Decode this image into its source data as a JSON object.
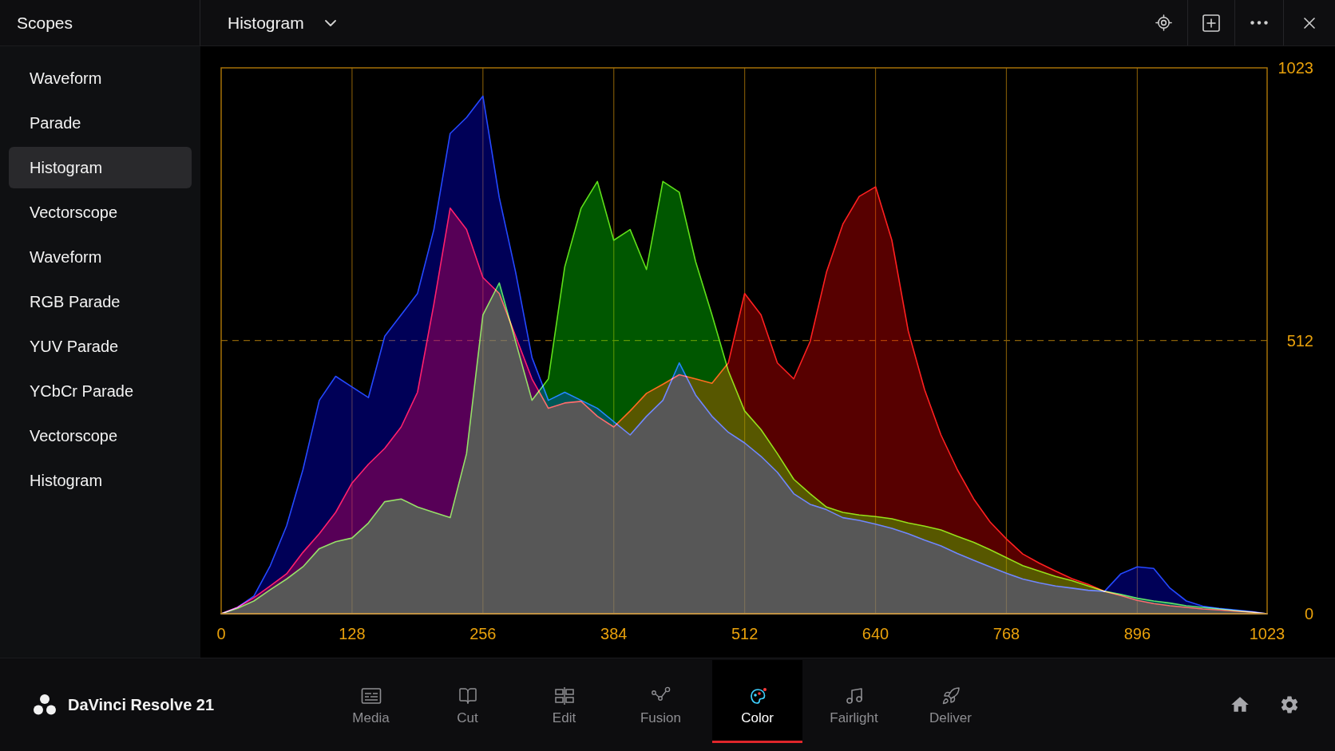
{
  "panel": {
    "title": "Scopes"
  },
  "scope_selector": {
    "value": "Histogram"
  },
  "sidebar": {
    "items": [
      {
        "label": "Waveform",
        "selected": false
      },
      {
        "label": "Parade",
        "selected": false
      },
      {
        "label": "Histogram",
        "selected": true
      },
      {
        "label": "Vectorscope",
        "selected": false
      },
      {
        "label": "Waveform",
        "selected": false
      },
      {
        "label": "RGB Parade",
        "selected": false
      },
      {
        "label": "YUV Parade",
        "selected": false
      },
      {
        "label": "YCbCr Parade",
        "selected": false
      },
      {
        "label": "Vectorscope",
        "selected": false
      },
      {
        "label": "Histogram",
        "selected": false
      }
    ]
  },
  "histogram": {
    "chart_data": {
      "type": "area",
      "x": [
        0,
        16,
        32,
        48,
        64,
        80,
        96,
        112,
        128,
        144,
        160,
        176,
        192,
        208,
        224,
        240,
        256,
        272,
        288,
        304,
        320,
        336,
        352,
        368,
        384,
        400,
        416,
        432,
        448,
        464,
        480,
        496,
        512,
        528,
        544,
        560,
        576,
        592,
        608,
        624,
        640,
        656,
        672,
        688,
        704,
        720,
        736,
        752,
        768,
        784,
        800,
        816,
        832,
        848,
        864,
        880,
        896,
        912,
        928,
        944,
        960,
        976,
        992,
        1008,
        1023
      ],
      "series": [
        {
          "color": "#2448ff",
          "values": [
            0,
            12,
            33,
            90,
            165,
            270,
            400,
            445,
            425,
            405,
            520,
            560,
            600,
            720,
            900,
            930,
            970,
            780,
            640,
            480,
            400,
            415,
            400,
            385,
            360,
            335,
            370,
            400,
            470,
            410,
            370,
            340,
            320,
            295,
            265,
            225,
            205,
            195,
            180,
            175,
            168,
            160,
            150,
            138,
            127,
            113,
            100,
            88,
            76,
            65,
            58,
            52,
            48,
            44,
            42,
            75,
            88,
            85,
            48,
            24,
            14,
            10,
            7,
            4,
            0
          ]
        },
        {
          "color": "#ff2020",
          "values": [
            0,
            12,
            30,
            52,
            75,
            115,
            150,
            190,
            245,
            280,
            310,
            350,
            415,
            580,
            760,
            720,
            630,
            600,
            520,
            440,
            385,
            395,
            398,
            370,
            350,
            380,
            413,
            430,
            448,
            440,
            432,
            470,
            600,
            560,
            470,
            440,
            510,
            640,
            730,
            782,
            800,
            700,
            530,
            420,
            335,
            270,
            215,
            172,
            140,
            112,
            95,
            80,
            66,
            55,
            42,
            34,
            25,
            19,
            15,
            12,
            9,
            7,
            5,
            3,
            0
          ]
        },
        {
          "color": "#5fe01a",
          "values": [
            0,
            10,
            24,
            45,
            65,
            88,
            122,
            135,
            142,
            170,
            210,
            215,
            200,
            190,
            180,
            300,
            560,
            620,
            510,
            400,
            440,
            650,
            760,
            810,
            700,
            720,
            645,
            810,
            790,
            660,
            560,
            455,
            380,
            345,
            300,
            252,
            225,
            200,
            190,
            185,
            182,
            178,
            170,
            164,
            157,
            145,
            134,
            120,
            105,
            90,
            80,
            70,
            62,
            52,
            42,
            36,
            29,
            24,
            20,
            15,
            12,
            9,
            6,
            3,
            0
          ]
        }
      ],
      "xlim": [
        0,
        1023
      ],
      "ylim": [
        0,
        1023
      ],
      "xticks": [
        0,
        128,
        256,
        384,
        512,
        640,
        768,
        896,
        1023
      ],
      "yticks": [
        0,
        512,
        1023
      ],
      "grid": true,
      "ref_lines": [
        {
          "axis": "y",
          "value": 512
        }
      ]
    }
  },
  "app": {
    "name": "DaVinci Resolve 21"
  },
  "pages": [
    {
      "label": "Media",
      "selected": false
    },
    {
      "label": "Cut",
      "selected": false
    },
    {
      "label": "Edit",
      "selected": false
    },
    {
      "label": "Fusion",
      "selected": false
    },
    {
      "label": "Color",
      "selected": true
    },
    {
      "label": "Fairlight",
      "selected": false
    },
    {
      "label": "Deliver",
      "selected": false
    }
  ]
}
